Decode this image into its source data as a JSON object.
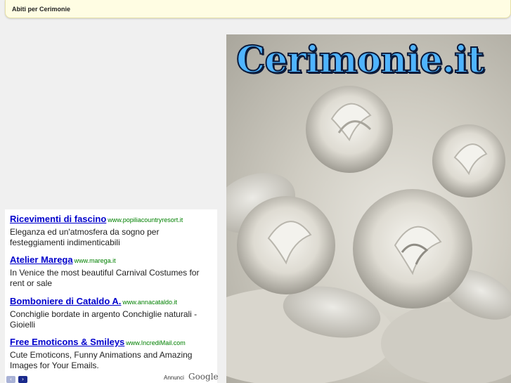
{
  "header": {
    "title": "Abiti per Cerimonie"
  },
  "ads": [
    {
      "title": "Ricevimenti di fascino",
      "url": "www.popiliacountryresort.it",
      "desc": "Eleganza ed un'atmosfera da sogno per festeggiamenti indimenticabili"
    },
    {
      "title": "Atelier Marega",
      "url": "www.marega.it",
      "desc": "In Venice the most beautiful Carnival Costumes for rent or sale"
    },
    {
      "title": "Bomboniere di Cataldo A.",
      "url": "www.annacataldo.it",
      "desc": "Conchiglie bordate in argento Conchiglie naturali - Gioielli"
    },
    {
      "title": "Free Emoticons & Smileys",
      "url": "www.IncrediMail.com",
      "desc": "Cute Emoticons, Funny Animations and Amazing Images for Your Emails."
    }
  ],
  "ad_footer": {
    "prev": "‹",
    "next": "›",
    "annunci": "Annunci",
    "google": "Google"
  },
  "hero": {
    "logo": "Cerimonie.it"
  },
  "colors": {
    "ad_title": "#0000cc",
    "ad_url": "#008000",
    "logo": "#4fb4ff"
  }
}
